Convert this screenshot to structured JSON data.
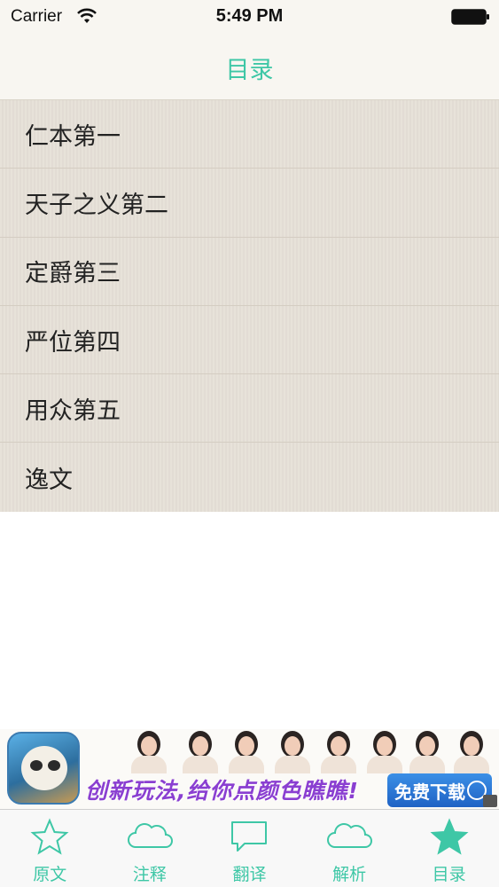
{
  "status_bar": {
    "carrier": "Carrier",
    "time": "5:49 PM",
    "wifi_icon": "wifi-icon",
    "battery_icon": "battery-icon"
  },
  "nav": {
    "title": "目录"
  },
  "toc": {
    "items": [
      {
        "label": "仁本第一"
      },
      {
        "label": "天子之义第二"
      },
      {
        "label": "定爵第三"
      },
      {
        "label": "严位第四"
      },
      {
        "label": "用众第五"
      },
      {
        "label": "逸文"
      }
    ]
  },
  "ad": {
    "text": "创新玩法,给你点颜色瞧瞧!",
    "button_label": "免费下载",
    "app_icon": "panda-game-icon"
  },
  "tab_bar": {
    "tabs": [
      {
        "label": "原文",
        "icon": "star-outline-icon"
      },
      {
        "label": "注释",
        "icon": "cloud-icon"
      },
      {
        "label": "翻译",
        "icon": "speech-bubble-icon"
      },
      {
        "label": "解析",
        "icon": "cloud-icon"
      },
      {
        "label": "目录",
        "icon": "star-filled-icon"
      }
    ],
    "selected": "目录"
  },
  "colors": {
    "accent": "#3ec7a6",
    "list_background": "#e6e0d7",
    "nav_background": "#f8f6f1"
  }
}
